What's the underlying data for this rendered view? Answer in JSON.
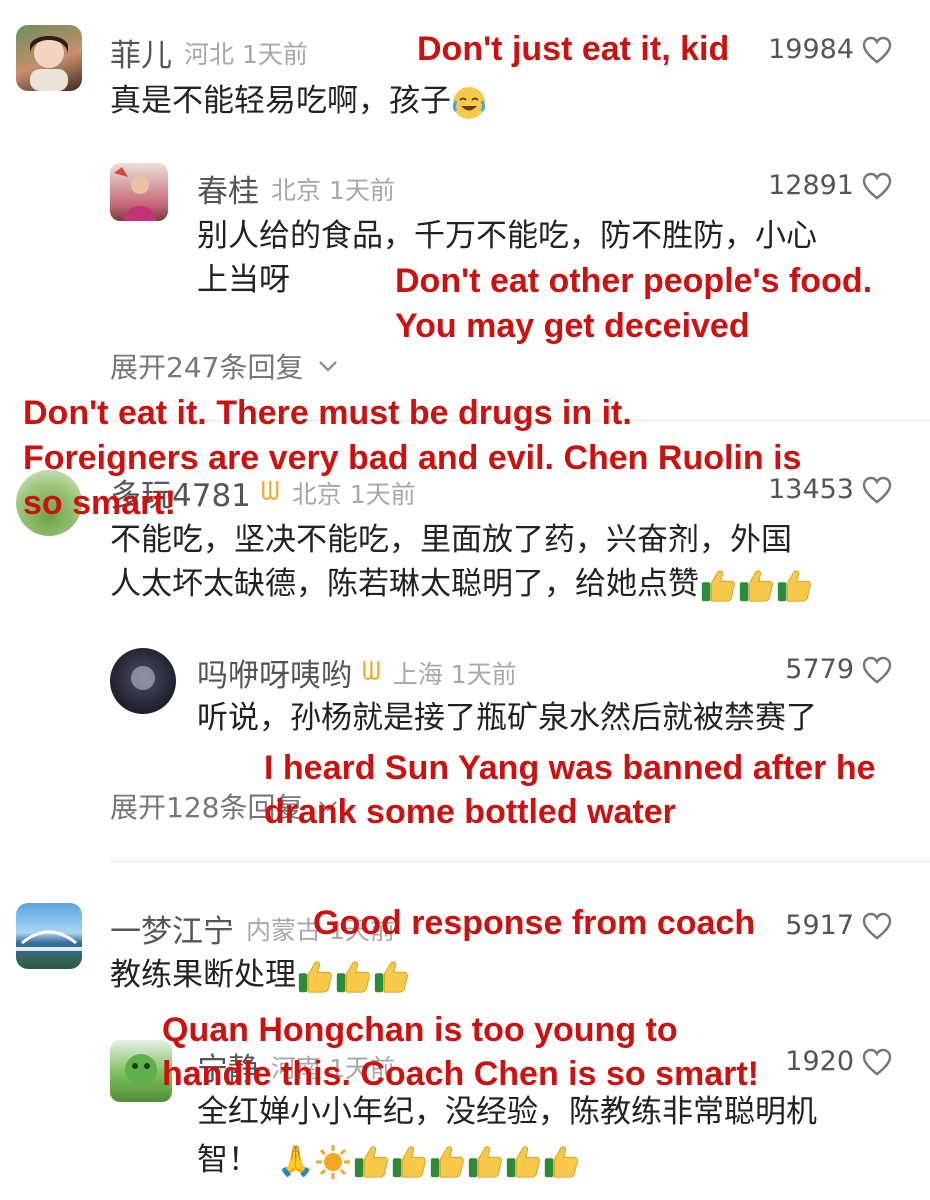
{
  "comments": [
    {
      "user": "菲儿",
      "location": "河北",
      "time": "1天前",
      "likes": "19984",
      "text": "真是不能轻易吃啊，孩子",
      "reply": {
        "user": "春桂",
        "location": "北京",
        "time": "1天前",
        "likes": "12891",
        "text_line1": "别人给的食品，千万不能吃，防不胜防，小心",
        "text_line2": "上当呀"
      },
      "expand": "展开247条回复"
    },
    {
      "user": "多玩4781",
      "location": "北京",
      "time": "1天前",
      "likes": "13453",
      "text_line1": "不能吃，坚决不能吃，里面放了药，兴奋剂，外国",
      "text_line2": "人太坏太缺德，陈若琳太聪明了，给她点赞",
      "reply": {
        "user": "吗咿呀咦哟",
        "location": "上海",
        "time": "1天前",
        "likes": "5779",
        "text": "听说，孙杨就是接了瓶矿泉水然后就被禁赛了"
      },
      "expand": "展开128条回复"
    },
    {
      "user": "一梦江宁",
      "location": "内蒙古",
      "time": "1天前",
      "likes": "5917",
      "text": "教练果断处理",
      "reply": {
        "user": "宁静",
        "location": "河南",
        "time": "1天前",
        "likes": "1920",
        "text_line1": "全红婵小小年纪，没经验，陈教练非常聪明机",
        "text_line2": "智！"
      }
    }
  ],
  "annotations": {
    "a1": "Don't just eat it, kid",
    "a2_line1": "Don't eat other people's food.",
    "a2_line2": "You may get deceived",
    "a3_line1": "Don't eat it. There must be drugs in it.",
    "a3_line2": "Foreigners are very bad and evil. Chen Ruolin is",
    "a3_line3": "so smart!",
    "a4_line1": "I heard Sun Yang was banned after he",
    "a4_line2": "drank some bottled water",
    "a5": "Good response from coach",
    "a6_line1": "Quan Hongchan is too young to",
    "a6_line2": "handle this. Coach Chen is so smart!"
  },
  "colors": {
    "annotation": "#cc1111",
    "badge": "#f0a830",
    "meta": "#a8a8a8"
  },
  "icons": [
    "heart-outline-icon",
    "chevron-down-icon",
    "thumbs-up-emoji",
    "crying-laugh-emoji",
    "pray-emoji",
    "sun-emoji"
  ]
}
